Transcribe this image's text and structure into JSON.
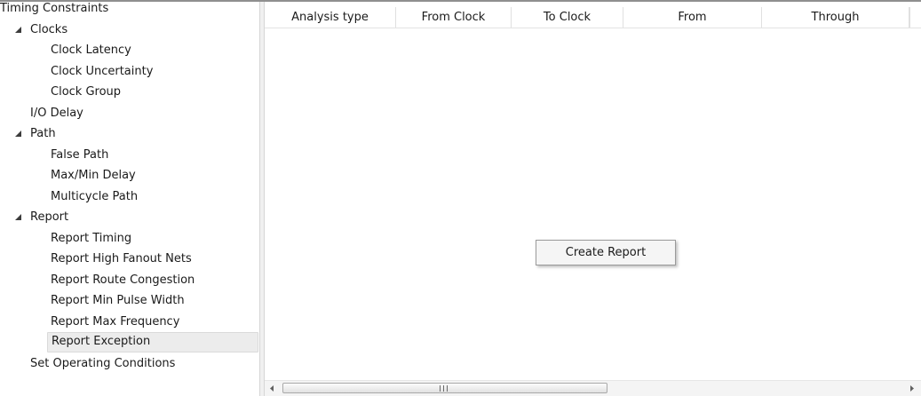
{
  "tree": {
    "items": [
      {
        "label": "Timing Constraints",
        "level": 0,
        "expander": "none"
      },
      {
        "label": "Clocks",
        "level": 1,
        "expander": "expanded"
      },
      {
        "label": "Clock Latency",
        "level": 2,
        "expander": "none"
      },
      {
        "label": "Clock Uncertainty",
        "level": 2,
        "expander": "none"
      },
      {
        "label": "Clock Group",
        "level": 2,
        "expander": "none"
      },
      {
        "label": "I/O Delay",
        "level": 1,
        "expander": "none"
      },
      {
        "label": "Path",
        "level": 1,
        "expander": "expanded"
      },
      {
        "label": "False Path",
        "level": 2,
        "expander": "none"
      },
      {
        "label": "Max/Min Delay",
        "level": 2,
        "expander": "none"
      },
      {
        "label": "Multicycle Path",
        "level": 2,
        "expander": "none"
      },
      {
        "label": "Report",
        "level": 1,
        "expander": "expanded"
      },
      {
        "label": "Report Timing",
        "level": 2,
        "expander": "none"
      },
      {
        "label": "Report High Fanout Nets",
        "level": 2,
        "expander": "none"
      },
      {
        "label": "Report Route Congestion",
        "level": 2,
        "expander": "none"
      },
      {
        "label": "Report Min Pulse Width",
        "level": 2,
        "expander": "none"
      },
      {
        "label": "Report Max Frequency",
        "level": 2,
        "expander": "none"
      },
      {
        "label": "Report Exception",
        "level": 2,
        "expander": "none",
        "selected": true
      },
      {
        "label": "Set Operating Conditions",
        "level": 1,
        "expander": "none"
      }
    ],
    "expander_icon": "triangle-expanded-icon"
  },
  "grid": {
    "columns": [
      "Analysis type",
      "From Clock",
      "To Clock",
      "From",
      "Through"
    ],
    "rows": []
  },
  "context_menu": {
    "items": [
      "Create Report"
    ]
  },
  "scrollbar": {
    "left_icon": "scroll-left-arrow-icon",
    "right_icon": "scroll-right-arrow-icon",
    "grip_icon": "scroll-grip-icon",
    "grip_text": "III"
  },
  "colors": {
    "selection_background": "#ececec",
    "border": "#9a9a9a",
    "background": "#ffffff"
  }
}
